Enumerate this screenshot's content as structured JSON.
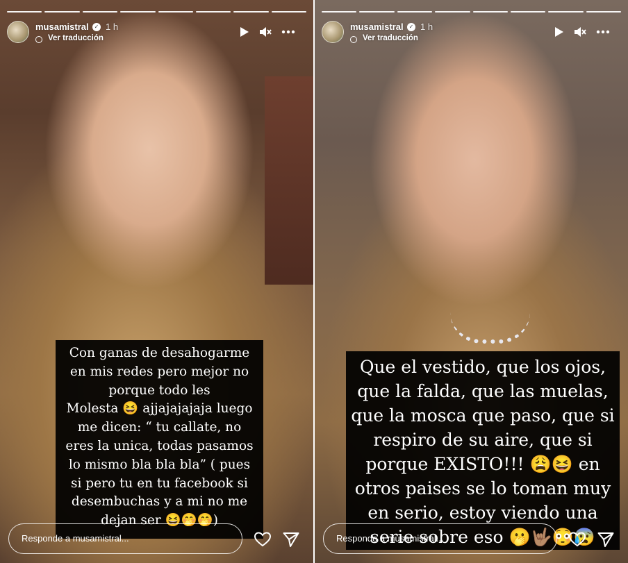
{
  "stories": [
    {
      "username": "musamistral",
      "time": "1 h",
      "translate_label": "Ver traducción",
      "caption_lines": [
        "Con ganas de desahogarme",
        "en mis redes pero mejor no",
        "porque todo les",
        "Molesta 😆 ajjajajajaja luego",
        "me dicen: “ tu callate, no",
        "eres la unica, todas pasamos",
        "lo mismo bla bla bla” ( pues",
        "si pero tu en tu facebook si",
        "desembuchas y a mi no me",
        "dejan ser 😆🤭🤭)"
      ],
      "reply_placeholder": "Responde a musamistral..."
    },
    {
      "username": "musamistral",
      "time": "1 h",
      "translate_label": "Ver traducción",
      "caption_lines": [
        "Que el vestido, que los ojos,",
        "que la falda, que las muelas,",
        "que la mosca que paso, que si",
        "respiro de su aire, que si",
        "porque EXISTO!!! 😩😆 en",
        "otros paises se lo toman muy",
        "en serio, estoy viendo una",
        "serie sobre eso 🫢🤟🏽😳😰"
      ],
      "reply_placeholder": "Responde a musamistral..."
    }
  ],
  "icons": {
    "play": "play-icon",
    "mute": "speaker-muted-icon",
    "more": "more-options-icon",
    "like": "heart-icon",
    "share": "send-icon",
    "verified": "verified-badge-icon",
    "translate": "globe-icon"
  },
  "colors": {
    "caption_bg": "#000000",
    "text": "#ffffff"
  }
}
